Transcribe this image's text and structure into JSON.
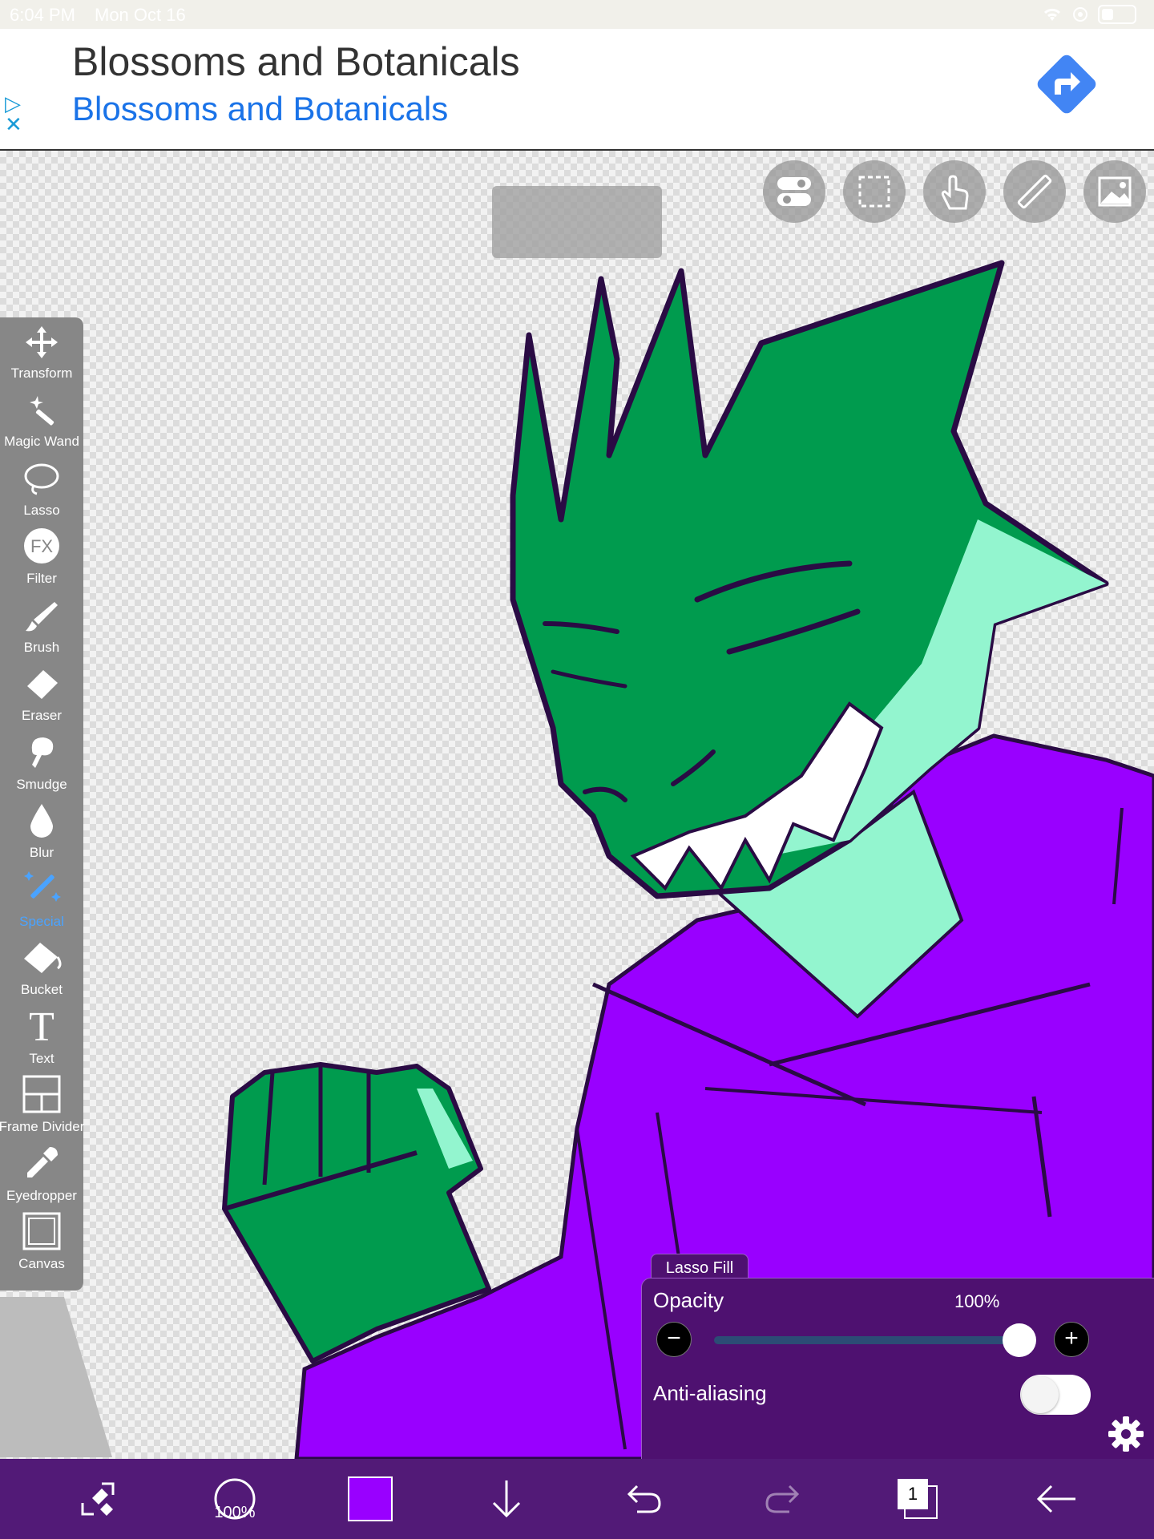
{
  "status_bar": {
    "time": "6:04 PM",
    "date": "Mon Oct 16"
  },
  "ad": {
    "title": "Blossoms and Botanicals",
    "subtitle": "Blossoms and Botanicals",
    "close_glyph": "✕",
    "choices_glyph": "▷",
    "accent": "#4285f4"
  },
  "toolbar": {
    "tools": [
      {
        "label": "Transform",
        "icon": "move-icon"
      },
      {
        "label": "Magic Wand",
        "icon": "magic-wand-icon"
      },
      {
        "label": "Lasso",
        "icon": "lasso-icon"
      },
      {
        "label": "Filter",
        "icon": "fx-icon",
        "glyph": "FX"
      },
      {
        "label": "Brush",
        "icon": "brush-icon"
      },
      {
        "label": "Eraser",
        "icon": "eraser-icon"
      },
      {
        "label": "Smudge",
        "icon": "smudge-icon"
      },
      {
        "label": "Blur",
        "icon": "drop-icon"
      },
      {
        "label": "Special",
        "icon": "special-icon",
        "active": true
      },
      {
        "label": "Bucket",
        "icon": "bucket-icon"
      },
      {
        "label": "Text",
        "icon": "text-icon",
        "glyph": "T"
      },
      {
        "label": "Frame Divider",
        "icon": "frame-divider-icon"
      },
      {
        "label": "Eyedropper",
        "icon": "eyedropper-icon"
      },
      {
        "label": "Canvas",
        "icon": "canvas-icon"
      }
    ]
  },
  "top_buttons": [
    "toggle-icon",
    "selection-icon",
    "touch-icon",
    "ruler-icon",
    "image-icon"
  ],
  "lasso_panel": {
    "tab_label": "Lasso Fill",
    "opacity_label": "Opacity",
    "opacity_value": "100%",
    "opacity_fraction": 1.0,
    "minus_glyph": "−",
    "plus_glyph": "+",
    "antialias_label": "Anti-aliasing",
    "antialias_on": false
  },
  "bottom_bar": {
    "brush_size": "100%",
    "layer_count": "1",
    "current_color": "#9900ff"
  },
  "colors": {
    "hoodie": "#9900ff",
    "skin": "#009b4e",
    "light_skin": "#93f5cf",
    "outline": "#2a0b44",
    "panel": "#4e1170"
  }
}
